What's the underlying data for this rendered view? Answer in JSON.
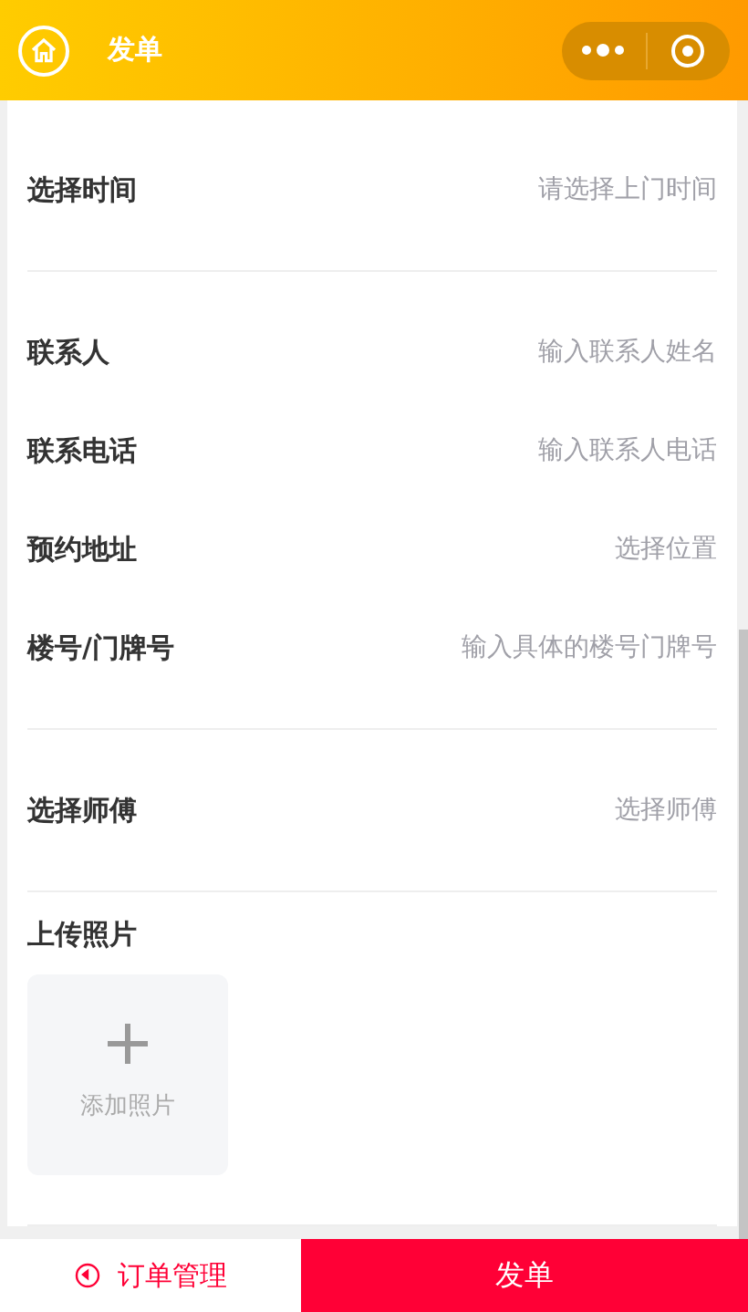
{
  "header": {
    "title": "发单"
  },
  "sections": [
    {
      "fields": [
        {
          "label": "选择时间",
          "placeholder": "请选择上门时间"
        }
      ]
    },
    {
      "fields": [
        {
          "label": "联系人",
          "placeholder": "输入联系人姓名"
        },
        {
          "label": "联系电话",
          "placeholder": "输入联系人电话"
        },
        {
          "label": "预约地址",
          "placeholder": "选择位置"
        },
        {
          "label": "楼号/门牌号",
          "placeholder": "输入具体的楼号门牌号"
        }
      ]
    },
    {
      "fields": [
        {
          "label": "选择师傅",
          "placeholder": "选择师傅"
        }
      ]
    }
  ],
  "upload": {
    "label": "上传照片",
    "button": "添加照片"
  },
  "bottom_bar": {
    "orders": "订单管理",
    "submit": "发单"
  }
}
